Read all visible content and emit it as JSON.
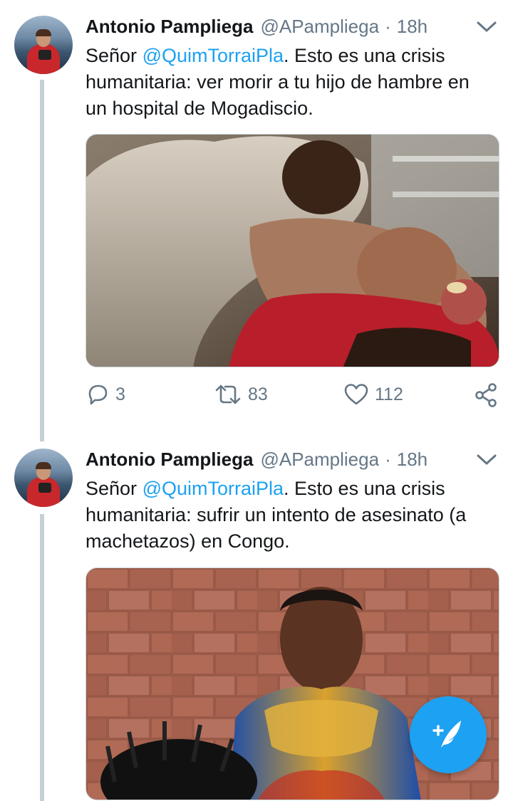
{
  "tweets": [
    {
      "author_name": "Antonio Pampliega",
      "handle": "@APampliega",
      "separator": "·",
      "time": "18h",
      "text_prefix": "Señor ",
      "mention": "@QuimTorraiPla",
      "text_suffix": ". Esto es una crisis humanitaria: ver morir a tu hijo de hambre en un hospital de Mogadiscio.",
      "media_icon": "photo-mother-and-sick-child-hospital",
      "reply_count": "3",
      "retweet_count": "83",
      "like_count": "112"
    },
    {
      "author_name": "Antonio Pampliega",
      "handle": "@APampliega",
      "separator": "·",
      "time": "18h",
      "text_prefix": "Señor ",
      "mention": "@QuimTorraiPla",
      "text_suffix": ". Esto es una crisis humanitaria: sufrir un intento de asesinato (a machetazos) en Congo.",
      "media_icon": "photo-woman-in-patterned-dress-brick-wall"
    }
  ],
  "icons": {
    "reply": "speech-bubble-icon",
    "retweet": "retweet-arrows-icon",
    "like": "heart-icon",
    "share": "share-icon",
    "caret": "chevron-down-icon",
    "compose": "compose-quill-icon"
  },
  "colors": {
    "accent": "#1da1f2",
    "text": "#14171a",
    "muted": "#657786",
    "thread_line": "#c4cfd6"
  }
}
